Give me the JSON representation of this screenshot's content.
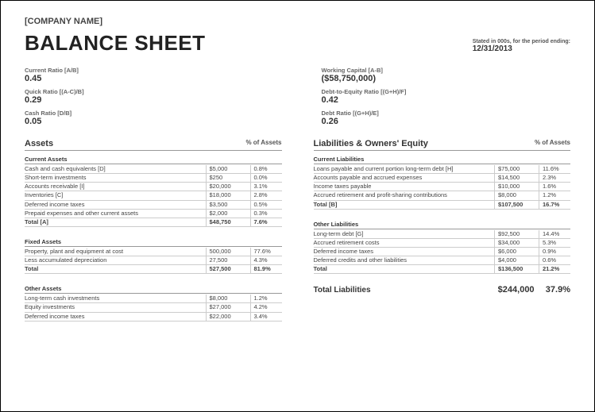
{
  "company": "[COMPANY NAME]",
  "title": "BALANCE SHEET",
  "period": {
    "label": "Stated in 000s, for the period ending:",
    "value": "12/31/2013"
  },
  "ratiosLeft": [
    {
      "label": "Current Ratio  [A/B]",
      "value": "0.45"
    },
    {
      "label": "Quick Ratio  [(A-C)/B]",
      "value": "0.29"
    },
    {
      "label": "Cash Ratio  [D/B]",
      "value": "0.05"
    }
  ],
  "ratiosRight": [
    {
      "label": "Working Capital  [A-B]",
      "value": "($58,750,000)"
    },
    {
      "label": "Debt-to-Equity Ratio  [(G+H)/F]",
      "value": "0.42"
    },
    {
      "label": "Debt Ratio  [(G+H)/E]",
      "value": "0.26"
    }
  ],
  "assets": {
    "heading": "Assets",
    "pctHeader": "% of Assets",
    "groups": [
      {
        "title": "Current Assets",
        "rows": [
          {
            "label": "Cash and cash equivalents  [D]",
            "val": "$5,000",
            "pct": "0.8%"
          },
          {
            "label": "Short-term investments",
            "val": "$250",
            "pct": "0.0%"
          },
          {
            "label": "Accounts receivable  [I]",
            "val": "$20,000",
            "pct": "3.1%"
          },
          {
            "label": "Inventories  [C]",
            "val": "$18,000",
            "pct": "2.8%"
          },
          {
            "label": "Deferred income taxes",
            "val": "$3,500",
            "pct": "0.5%"
          },
          {
            "label": "Prepaid expenses and other current assets",
            "val": "$2,000",
            "pct": "0.3%"
          },
          {
            "label": "Total  [A]",
            "val": "$48,750",
            "pct": "7.6%",
            "total": true
          }
        ]
      },
      {
        "title": "Fixed Assets",
        "rows": [
          {
            "label": "Property, plant and equipment at cost",
            "val": "500,000",
            "pct": "77.6%"
          },
          {
            "label": "Less accumulated depreciation",
            "val": "27,500",
            "pct": "4.3%"
          },
          {
            "label": "Total",
            "val": "527,500",
            "pct": "81.9%",
            "total": true
          }
        ]
      },
      {
        "title": "Other Assets",
        "rows": [
          {
            "label": "Long-term cash investments",
            "val": "$8,000",
            "pct": "1.2%"
          },
          {
            "label": "Equity investments",
            "val": "$27,000",
            "pct": "4.2%"
          },
          {
            "label": "Deferred income taxes",
            "val": "$22,000",
            "pct": "3.4%"
          }
        ]
      }
    ]
  },
  "liabilities": {
    "heading": "Liabilities & Owners' Equity",
    "pctHeader": "% of Assets",
    "groups": [
      {
        "title": "Current Liabilities",
        "rows": [
          {
            "label": "Loans payable and current portion long-term debt  [H]",
            "val": "$75,000",
            "pct": "11.6%"
          },
          {
            "label": "Accounts payable and accrued expenses",
            "val": "$14,500",
            "pct": "2.3%"
          },
          {
            "label": "Income taxes payable",
            "val": "$10,000",
            "pct": "1.6%"
          },
          {
            "label": "Accrued retirement and profit-sharing contributions",
            "val": "$8,000",
            "pct": "1.2%"
          },
          {
            "label": "Total  [B]",
            "val": "$107,500",
            "pct": "16.7%",
            "total": true
          }
        ]
      },
      {
        "title": "Other Liabilities",
        "rows": [
          {
            "label": "Long-term debt  [G]",
            "val": "$92,500",
            "pct": "14.4%"
          },
          {
            "label": "Accrued retirement costs",
            "val": "$34,000",
            "pct": "5.3%"
          },
          {
            "label": "Deferred income taxes",
            "val": "$6,000",
            "pct": "0.9%"
          },
          {
            "label": "Deferred credits and other liabilities",
            "val": "$4,000",
            "pct": "0.6%"
          },
          {
            "label": "Total",
            "val": "$136,500",
            "pct": "21.2%",
            "total": true
          }
        ]
      }
    ],
    "grand": {
      "label": "Total Liabilities",
      "val": "$244,000",
      "pct": "37.9%"
    }
  }
}
